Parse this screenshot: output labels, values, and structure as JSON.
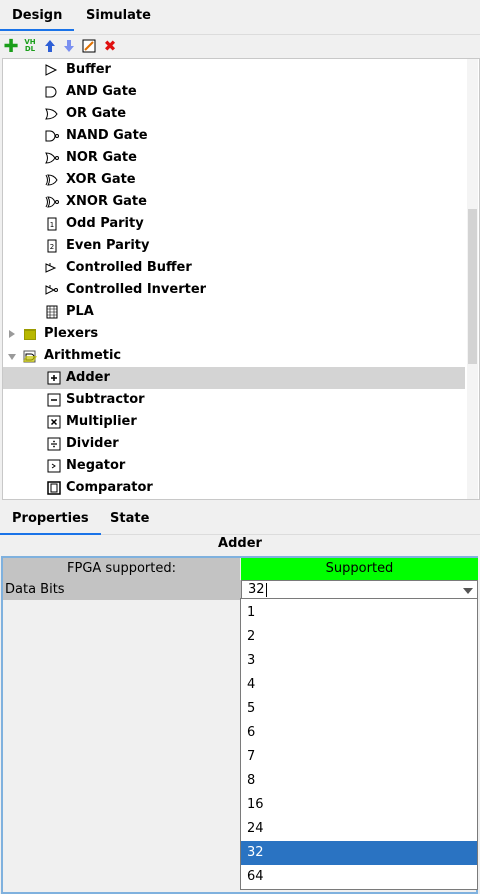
{
  "top_tabs": [
    "Design",
    "Simulate"
  ],
  "toolbar": {
    "icons": [
      "add-icon",
      "vhdl-icon",
      "move-up-icon",
      "move-down-icon",
      "edit-icon",
      "delete-icon"
    ],
    "vhdl_text_top": "VH",
    "vhdl_text_bottom": "DL",
    "colors": {
      "add": "#1a9e1a",
      "vhdl": "#1a9e1a",
      "up": "#2d5fd6",
      "down": "#7a8ff0",
      "delete": "#e01010"
    }
  },
  "tree": {
    "items": [
      {
        "label": "Buffer",
        "icon": "buffer-icon",
        "glyph": "▷"
      },
      {
        "label": "AND Gate",
        "icon": "and-gate-icon",
        "glyph": "D"
      },
      {
        "label": "OR Gate",
        "icon": "or-gate-icon",
        "glyph": "D"
      },
      {
        "label": "NAND Gate",
        "icon": "nand-gate-icon",
        "glyph": "D"
      },
      {
        "label": "NOR Gate",
        "icon": "nor-gate-icon",
        "glyph": "D"
      },
      {
        "label": "XOR Gate",
        "icon": "xor-gate-icon",
        "glyph": "D"
      },
      {
        "label": "XNOR Gate",
        "icon": "xnor-gate-icon",
        "glyph": "D"
      },
      {
        "label": "Odd Parity",
        "icon": "odd-parity-icon",
        "glyph": "1"
      },
      {
        "label": "Even Parity",
        "icon": "even-parity-icon",
        "glyph": "2"
      },
      {
        "label": "Controlled Buffer",
        "icon": "controlled-buffer-icon",
        "glyph": "▷"
      },
      {
        "label": "Controlled Inverter",
        "icon": "controlled-inverter-icon",
        "glyph": "▷"
      },
      {
        "label": "PLA",
        "icon": "pla-icon",
        "glyph": "▦"
      },
      {
        "label": "Plexers",
        "icon": "folder-icon",
        "folder": true
      },
      {
        "label": "Arithmetic",
        "icon": "folder-open-icon",
        "folder": true
      },
      {
        "label": "Adder",
        "icon": "adder-icon",
        "glyph": "+"
      },
      {
        "label": "Subtractor",
        "icon": "subtractor-icon",
        "glyph": "-"
      },
      {
        "label": "Multiplier",
        "icon": "multiplier-icon",
        "glyph": "×"
      },
      {
        "label": "Divider",
        "icon": "divider-icon",
        "glyph": "÷"
      },
      {
        "label": "Negator",
        "icon": "negator-icon",
        "glyph": "-"
      },
      {
        "label": "Comparator",
        "icon": "comparator-icon",
        "glyph": " "
      }
    ],
    "selected": "Adder"
  },
  "properties_tabs": [
    "Properties",
    "State"
  ],
  "component_title": "Adder",
  "properties": {
    "fpga_label": "FPGA supported:",
    "fpga_value": "Supported",
    "fpga_color": "#00ff00",
    "data_bits_label": "Data Bits",
    "data_bits_value": "32"
  },
  "dropdown_options": [
    "1",
    "2",
    "3",
    "4",
    "5",
    "6",
    "7",
    "8",
    "16",
    "24",
    "32",
    "64"
  ],
  "dropdown_selected": "32",
  "accent": "#2a73c2"
}
